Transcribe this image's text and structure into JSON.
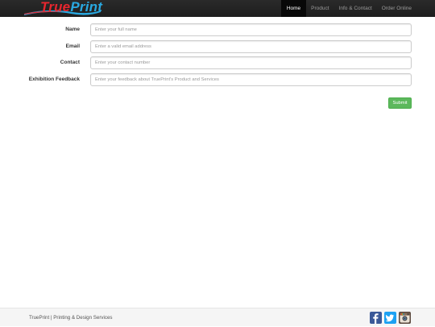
{
  "brand": {
    "part1": "True",
    "part2": "Print"
  },
  "nav": {
    "items": [
      {
        "label": "Home",
        "active": true
      },
      {
        "label": "Product",
        "active": false
      },
      {
        "label": "Info & Contact",
        "active": false
      },
      {
        "label": "Order Online",
        "active": false
      }
    ]
  },
  "form": {
    "fields": [
      {
        "label": "Name",
        "placeholder": "Enter your full name",
        "value": ""
      },
      {
        "label": "Email",
        "placeholder": "Enter a valid email address",
        "value": ""
      },
      {
        "label": "Contact",
        "placeholder": "Enter your contact number",
        "value": ""
      },
      {
        "label": "Exhibition Feedback",
        "placeholder": "Enter your feedback about TruePrint's Product and Services",
        "value": ""
      }
    ],
    "submit_label": "Submit"
  },
  "footer": {
    "text": "TruePrint | Printing & Design Services",
    "social_icons": [
      "facebook-icon",
      "twitter-icon",
      "instagram-icon"
    ]
  },
  "colors": {
    "navbar": "#222222",
    "nav_active": "#080808",
    "submit": "#5cb85c",
    "brand_red": "#e8262e",
    "brand_blue": "#29a9e1"
  }
}
